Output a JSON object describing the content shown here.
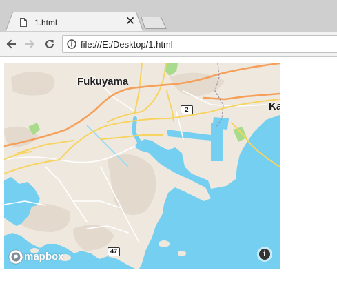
{
  "browser": {
    "tab_title": "1.html",
    "tab_close_glyph": "✕",
    "url": "file:///E:/Desktop/1.html",
    "icons": {
      "back": "back-arrow-icon",
      "forward": "forward-arrow-icon",
      "reload": "reload-icon",
      "page_info": "info-icon",
      "document": "document-icon"
    }
  },
  "map": {
    "places": [
      {
        "name": "Fukuyama"
      },
      {
        "name": "Ka"
      }
    ],
    "route_shields": [
      "2",
      "47"
    ],
    "attribution": {
      "logo_text": "mapbox",
      "info_glyph": "i"
    },
    "colors": {
      "land": "#efe8de",
      "water": "#75cff0",
      "major_road": "#f5a05a",
      "secondary_road": "#f7d35f",
      "park": "#a8dc8c"
    }
  }
}
